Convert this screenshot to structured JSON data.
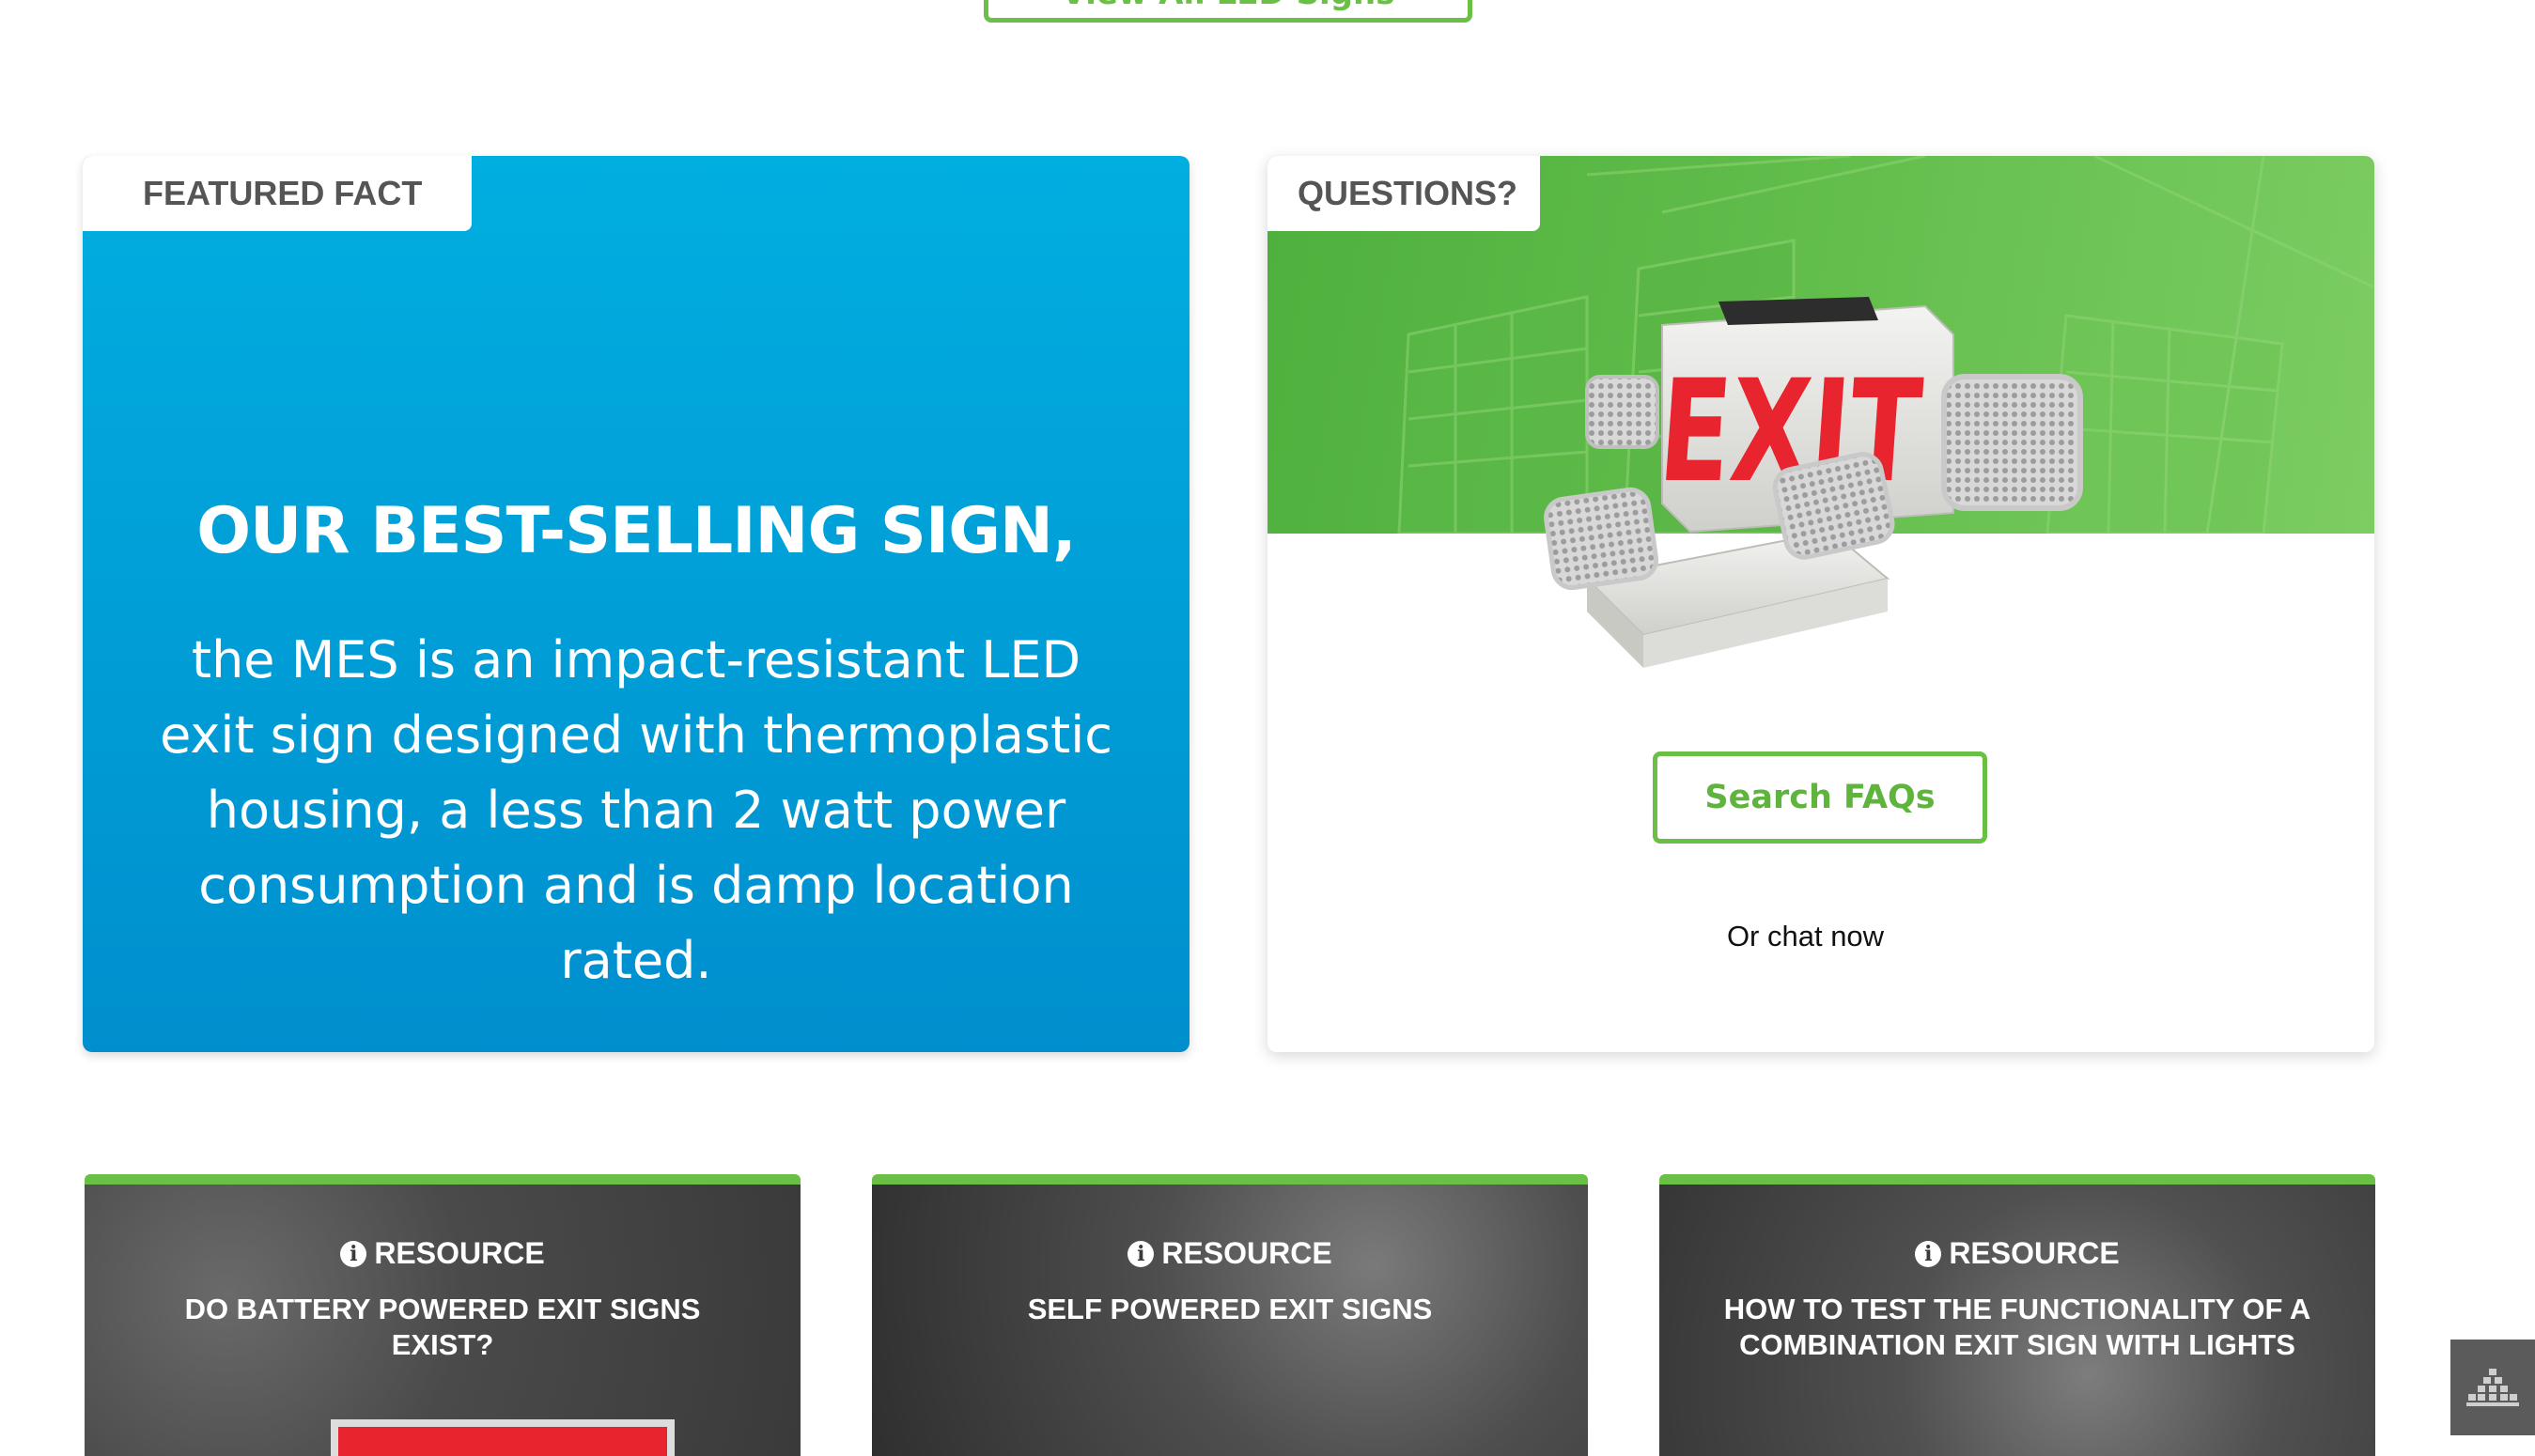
{
  "top_button": {
    "label": "View All LED Signs"
  },
  "featured_fact": {
    "tab_label": "FEATURED FACT",
    "heading": "OUR BEST-SELLING SIGN,",
    "body": "the MES is an impact-resistant LED exit sign designed with thermoplastic housing, a less than 2 watt power consumption and is damp location rated."
  },
  "questions": {
    "tab_label": "QUESTIONS?",
    "exit_text": "EXIT",
    "faq_button": "Search FAQs",
    "chat_text": "Or chat now"
  },
  "resources": [
    {
      "label": "RESOURCE",
      "title": "DO BATTERY POWERED EXIT SIGNS EXIST?"
    },
    {
      "label": "RESOURCE",
      "title": "SELF POWERED EXIT SIGNS"
    },
    {
      "label": "RESOURCE",
      "title": "HOW TO TEST THE FUNCTIONALITY OF A COMBINATION EXIT SIGN WITH LIGHTS"
    }
  ],
  "colors": {
    "brand_green": "#6abf45",
    "fact_blue_top": "#01aee0",
    "fact_blue_bottom": "#008fce",
    "exit_red": "#e8242f"
  }
}
